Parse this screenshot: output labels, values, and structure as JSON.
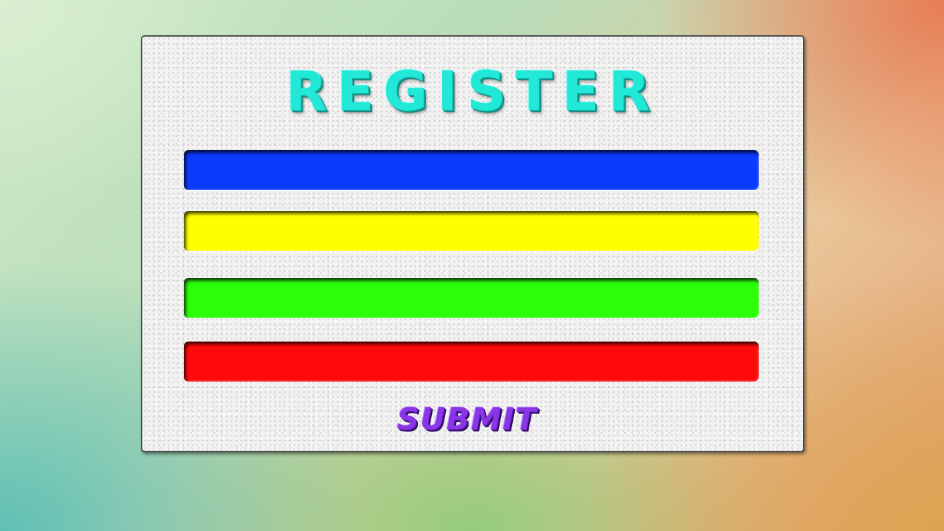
{
  "title": "REGISTER",
  "fields": [
    {
      "color": "#0a3bff",
      "placeholder": ""
    },
    {
      "color": "#ffff00",
      "placeholder": ""
    },
    {
      "color": "#2cff0a",
      "placeholder": ""
    },
    {
      "color": "#ff0a0a",
      "placeholder": ""
    }
  ],
  "submit_label": "SUBMIT",
  "colors": {
    "title": "#22e8d8",
    "submit": "#8a36e8",
    "panel": "#f1f1f1"
  }
}
